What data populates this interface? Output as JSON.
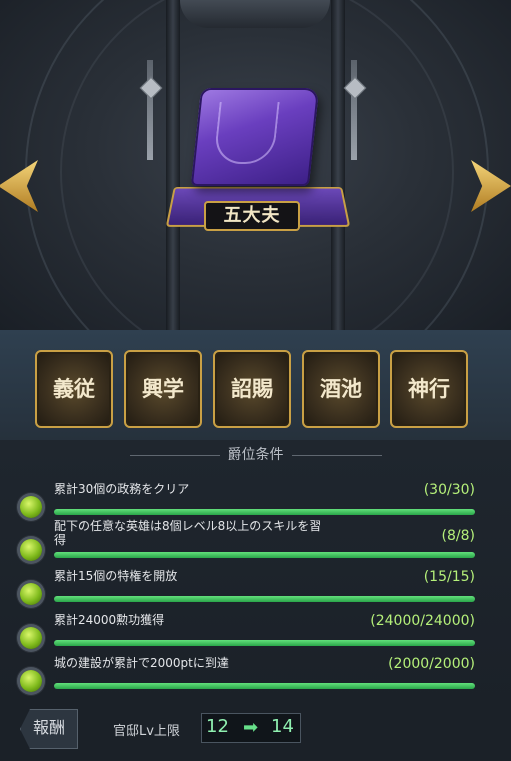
{
  "rank": {
    "name": "五大夫"
  },
  "nav": {
    "prev": "previous-arrow",
    "next": "next-arrow"
  },
  "actions": [
    {
      "label": "義従"
    },
    {
      "label": "興学"
    },
    {
      "label": "詔賜"
    },
    {
      "label": "酒池"
    },
    {
      "label": "神行"
    }
  ],
  "conditions_title": "爵位条件",
  "conditions": [
    {
      "text": "累計30個の政務をクリア",
      "count": "(30/30)",
      "progress": 1.0
    },
    {
      "text": "配下の任意な英雄は8個レベル8以上のスキルを習得",
      "count": "(8/8)",
      "progress": 1.0
    },
    {
      "text": "累計15個の特権を開放",
      "count": "(15/15)",
      "progress": 1.0
    },
    {
      "text": "累計24000勲功獲得",
      "count": "(24000/24000)",
      "progress": 1.0
    },
    {
      "text": "城の建設が累計で2000ptに到達",
      "count": "(2000/2000)",
      "progress": 1.0
    }
  ],
  "reward": {
    "tab_label": "報酬",
    "label": "官邸Lv上限",
    "from": "12",
    "arrow": "➡",
    "to": "14"
  },
  "colors": {
    "gold": "#c9a045",
    "progress_green": "#2aa64a",
    "count_green": "#b5f07a",
    "hat_purple": "#6a3fbf"
  }
}
